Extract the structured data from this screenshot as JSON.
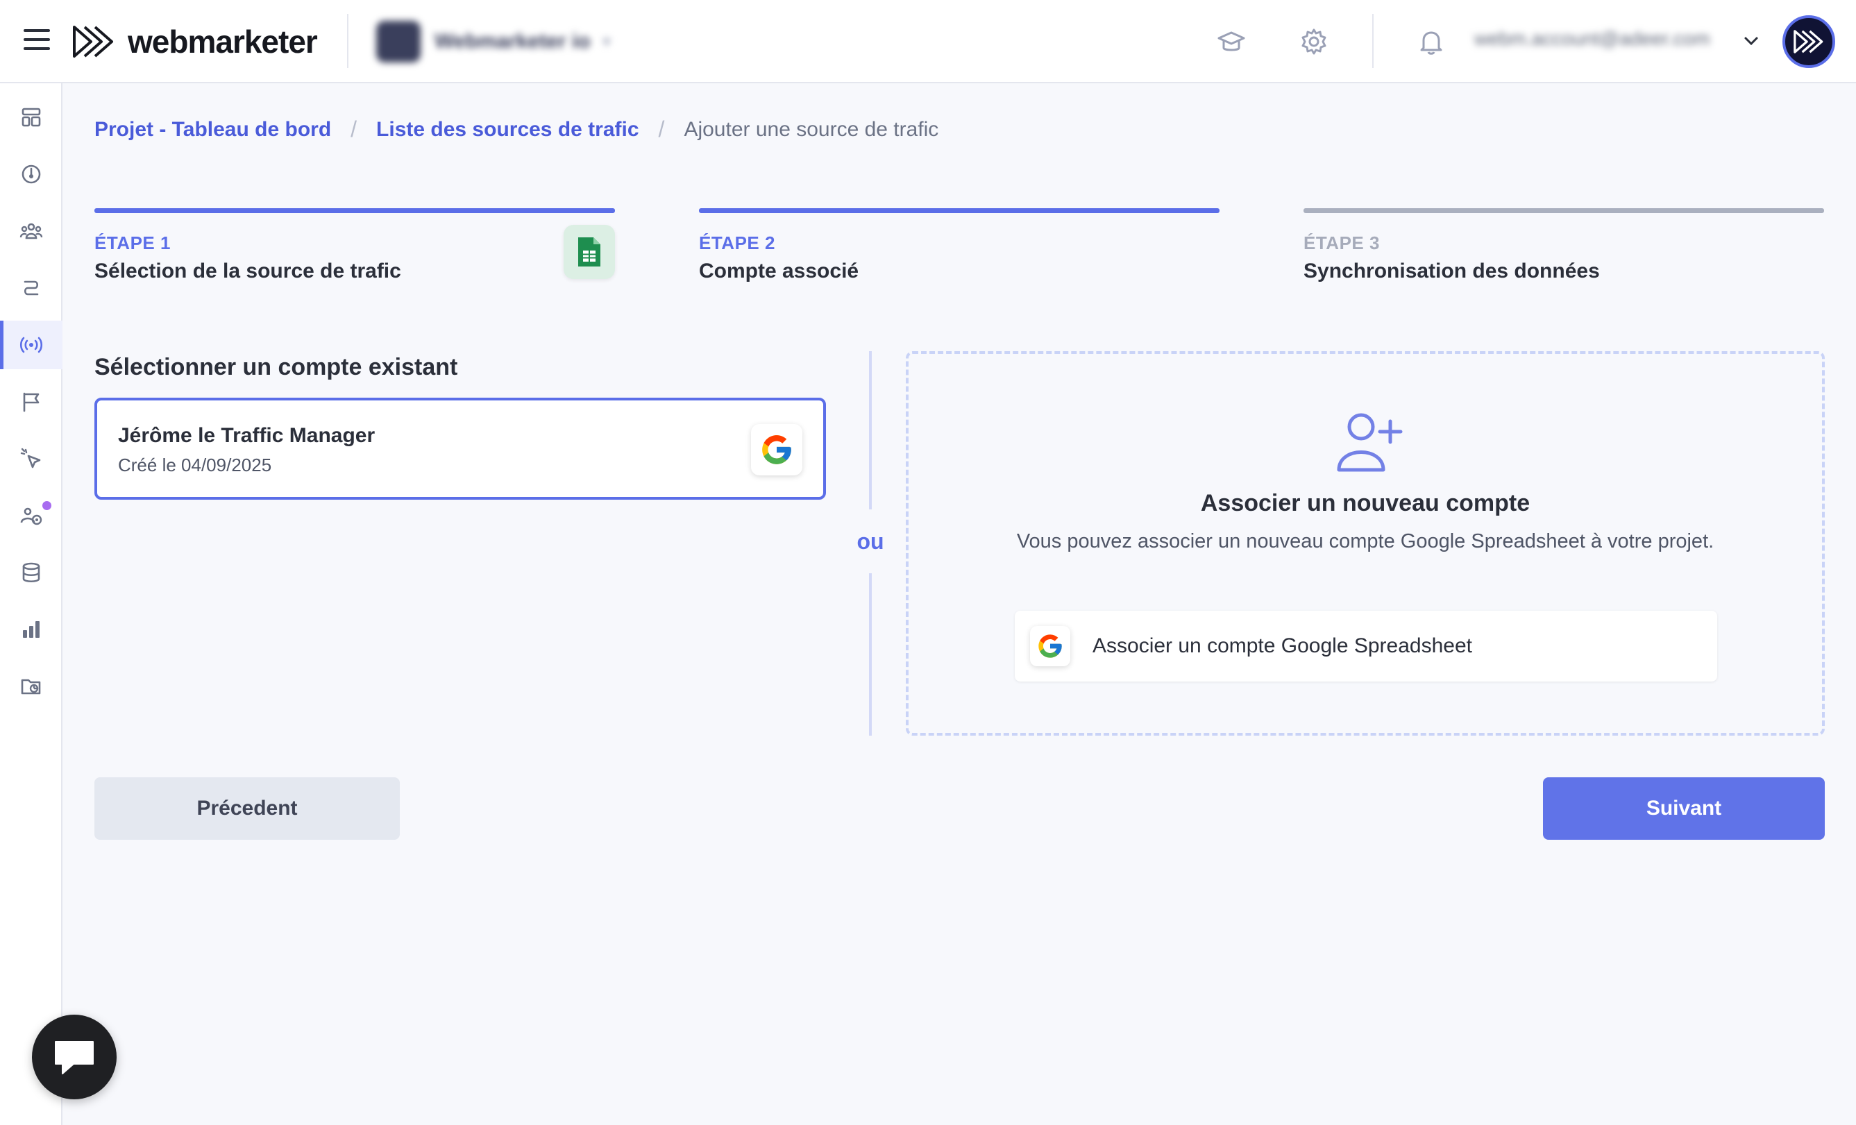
{
  "header": {
    "app_name": "webmarketer",
    "project_name": "Webmarketer io",
    "user_email": "webm.account@adeer.com",
    "icons": [
      "menu-icon",
      "graduation-cap-icon",
      "gear-icon",
      "bell-icon",
      "chevron-down-icon"
    ]
  },
  "sidebar": {
    "items": [
      {
        "name": "dashboard-icon"
      },
      {
        "name": "gauge-icon"
      },
      {
        "name": "users-icon"
      },
      {
        "name": "route-icon"
      },
      {
        "name": "broadcast-icon",
        "active": true
      },
      {
        "name": "flag-icon"
      },
      {
        "name": "cursor-click-icon"
      },
      {
        "name": "target-users-icon",
        "has_notification": true
      },
      {
        "name": "database-icon"
      },
      {
        "name": "bar-chart-icon"
      },
      {
        "name": "folder-chart-icon"
      }
    ]
  },
  "breadcrumb": {
    "items": [
      "Projet - Tableau de bord",
      "Liste des sources de trafic"
    ],
    "current": "Ajouter une source de trafic",
    "separator": "/"
  },
  "stepper": {
    "steps": [
      {
        "label": "ÉTAPE 1",
        "title": "Sélection de la source de trafic",
        "state": "done"
      },
      {
        "label": "ÉTAPE 2",
        "title": "Compte associé",
        "state": "active"
      },
      {
        "label": "ÉTAPE 3",
        "title": "Synchronisation des données",
        "state": "pending"
      }
    ]
  },
  "existing": {
    "title": "Sélectionner un compte existant",
    "account_name": "Jérôme le Traffic Manager",
    "account_created": "Créé le 04/09/2025"
  },
  "divider_label": "ou",
  "new_account": {
    "title": "Associer un nouveau compte",
    "description": "Vous pouvez associer un nouveau compte Google Spreadsheet à votre projet.",
    "button_label": "Associer un compte Google Spreadsheet"
  },
  "footer": {
    "prev_label": "Précedent",
    "next_label": "Suivant"
  },
  "colors": {
    "accent": "#5b6ee8",
    "link": "#4a5bd9",
    "background": "#f7f8fc",
    "sheets_green": "#1e8e4f"
  }
}
